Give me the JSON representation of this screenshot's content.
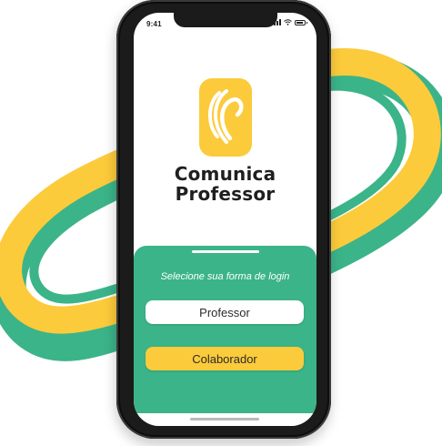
{
  "status_bar": {
    "time": "9:41"
  },
  "brand": {
    "line1": "Comunica",
    "line2": "Professor"
  },
  "login": {
    "prompt": "Selecione sua forma de login",
    "professor_label": "Professor",
    "colaborador_label": "Colaborador"
  },
  "colors": {
    "green": "#3bb489",
    "yellow": "#fccb3b",
    "phone_frame": "#1b1b1b"
  }
}
